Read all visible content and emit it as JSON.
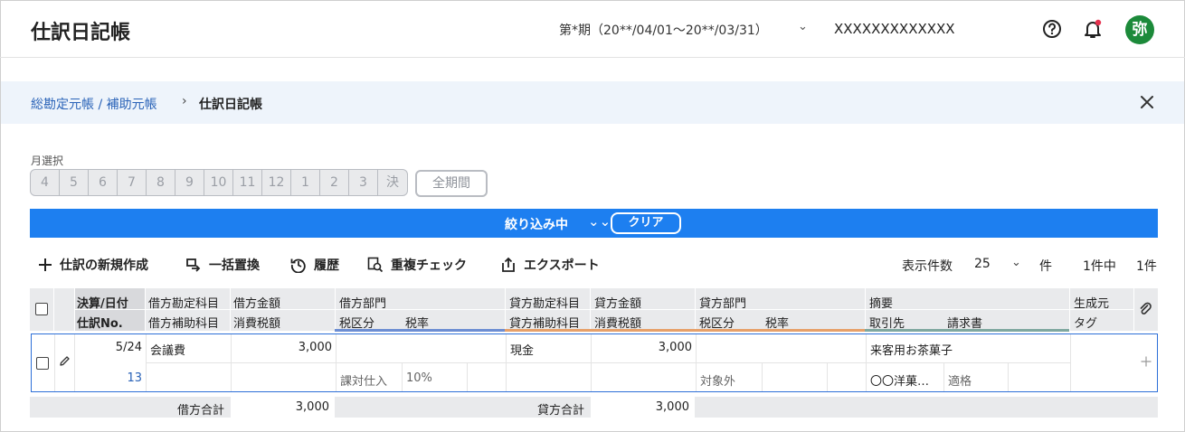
{
  "header": {
    "title": "仕訳日記帳",
    "period": "第*期（20**/04/01〜20**/03/31）",
    "company": "XXXXXXXXXXXXX",
    "avatar_initial": "弥",
    "avatar_color": "#1c8a3a",
    "notification_dot_color": "#e5304d"
  },
  "breadcrumb": {
    "parent": "総勘定元帳 / 補助元帳",
    "separator": "›",
    "current": "仕訳日記帳"
  },
  "month_selector": {
    "label": "月選択",
    "months": [
      "4",
      "5",
      "6",
      "7",
      "8",
      "9",
      "10",
      "11",
      "12",
      "1",
      "2",
      "3",
      "決"
    ],
    "all_period": "全期間"
  },
  "filter_bar": {
    "label": "絞り込み中",
    "clear": "クリア",
    "color": "#1d7ff0"
  },
  "toolbar": {
    "new_entry": "仕訳の新規作成",
    "bulk_replace": "一括置換",
    "history": "履歴",
    "duplicate_check": "重複チェック",
    "export": "エクスポート",
    "per_page_label": "表示件数",
    "per_page_value": "25",
    "per_page_unit": "件",
    "count_text": "1件中",
    "count_num": "1件"
  },
  "table": {
    "headers": {
      "date": "決算/日付",
      "slip_no": "仕訳No.",
      "debit_account": "借方勘定科目",
      "debit_sub_account": "借方補助科目",
      "debit_amount": "借方金額",
      "debit_tax_amount": "消費税額",
      "debit_dept": "借方部門",
      "debit_tax_cat": "税区分",
      "debit_tax_rate": "税率",
      "credit_account": "貸方勘定科目",
      "credit_sub_account": "貸方補助科目",
      "credit_amount": "貸方金額",
      "credit_tax_amount": "消費税額",
      "credit_dept": "貸方部門",
      "credit_tax_cat": "税区分",
      "credit_tax_rate": "税率",
      "memo": "摘要",
      "partner": "取引先",
      "invoice": "請求書",
      "origin": "生成元",
      "tag": "タグ"
    },
    "rows": [
      {
        "date": "5/24",
        "slip_no": "13",
        "debit_account": "会議費",
        "debit_amount": "3,000",
        "debit_tax_cat": "課対仕入",
        "debit_tax_rate": "10%",
        "credit_account": "現金",
        "credit_amount": "3,000",
        "credit_tax_cat": "対象外",
        "memo": "来客用お茶菓子",
        "partner": "〇〇洋菓…",
        "invoice": "適格"
      }
    ],
    "totals": {
      "debit_label": "借方合計",
      "debit_total": "3,000",
      "credit_label": "貸方合計",
      "credit_total": "3,000"
    }
  }
}
